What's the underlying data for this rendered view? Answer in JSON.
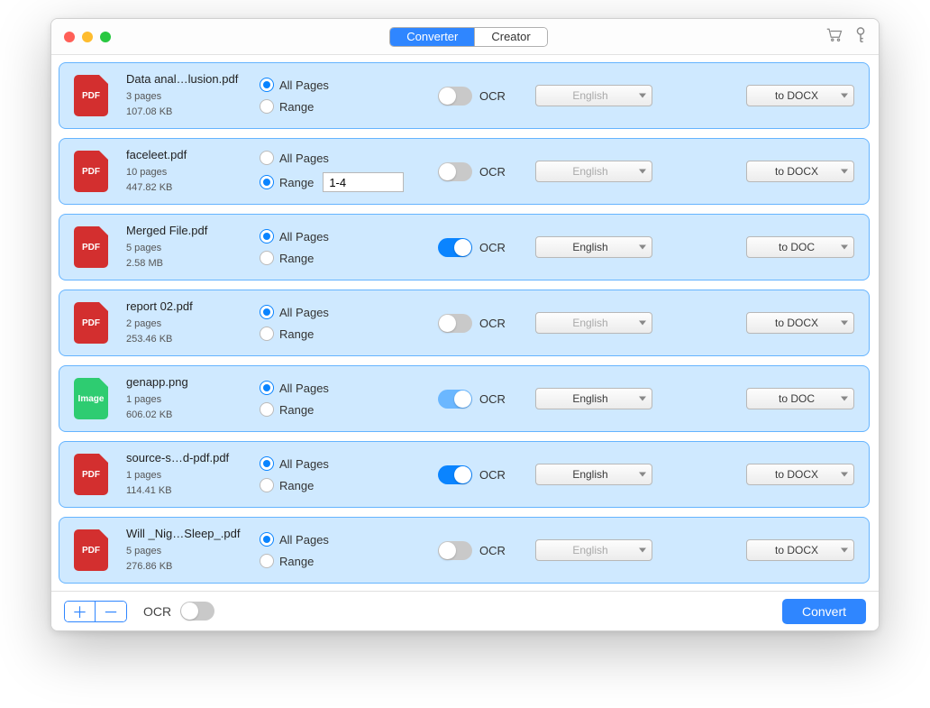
{
  "titlebar": {
    "tabs": [
      "Converter",
      "Creator"
    ],
    "activeTab": 0,
    "icons": {
      "cart": "cart-icon",
      "key": "key-icon"
    }
  },
  "labels": {
    "allPages": "All Pages",
    "range": "Range",
    "ocr": "OCR"
  },
  "footer": {
    "ocrLabel": "OCR",
    "ocrMasterOn": false,
    "convertLabel": "Convert"
  },
  "files": [
    {
      "name": "Data anal…lusion.pdf",
      "pages": "3 pages",
      "size": "107.08 KB",
      "type": "pdf",
      "pageMode": "all",
      "rangeValue": "",
      "ocr": false,
      "lang": "English",
      "langDisabled": true,
      "format": "to DOCX"
    },
    {
      "name": "faceleet.pdf",
      "pages": "10 pages",
      "size": "447.82 KB",
      "type": "pdf",
      "pageMode": "range",
      "rangeValue": "1-4",
      "ocr": false,
      "lang": "English",
      "langDisabled": true,
      "format": "to DOCX"
    },
    {
      "name": "Merged File.pdf",
      "pages": "5 pages",
      "size": "2.58 MB",
      "type": "pdf",
      "pageMode": "all",
      "rangeValue": "",
      "ocr": true,
      "lang": "English",
      "langDisabled": false,
      "format": "to DOC"
    },
    {
      "name": "report 02.pdf",
      "pages": "2 pages",
      "size": "253.46 KB",
      "type": "pdf",
      "pageMode": "all",
      "rangeValue": "",
      "ocr": false,
      "lang": "English",
      "langDisabled": true,
      "format": "to DOCX"
    },
    {
      "name": "genapp.png",
      "pages": "1 pages",
      "size": "606.02 KB",
      "type": "image",
      "pageMode": "all",
      "rangeValue": "",
      "ocr": true,
      "ocrLight": true,
      "lang": "English",
      "langDisabled": false,
      "format": "to DOC"
    },
    {
      "name": "source-s…d-pdf.pdf",
      "pages": "1 pages",
      "size": "114.41 KB",
      "type": "pdf",
      "pageMode": "all",
      "rangeValue": "",
      "ocr": true,
      "lang": "English",
      "langDisabled": false,
      "format": "to DOCX"
    },
    {
      "name": "Will _Nig…Sleep_.pdf",
      "pages": "5 pages",
      "size": "276.86 KB",
      "type": "pdf",
      "pageMode": "all",
      "rangeValue": "",
      "ocr": false,
      "lang": "English",
      "langDisabled": true,
      "format": "to DOCX"
    }
  ]
}
